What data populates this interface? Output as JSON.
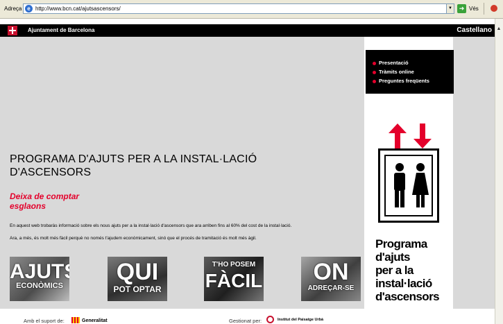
{
  "browser": {
    "address_label": "Adreça",
    "url": "http://www.bcn.cat/ajutsascensors/",
    "go_label": "Vés"
  },
  "site": {
    "name": "Ajuntament de Barcelona",
    "language_link": "Castellano"
  },
  "menu": {
    "items": [
      "Presentació",
      "Tràmits online",
      "Preguntes freqüents"
    ]
  },
  "content": {
    "title_line1": "PROGRAMA D'AJUTS PER A LA INSTAL·LACIÓ",
    "title_line2": "D'ASCENSORS",
    "slogan_line1": "Deixa de comptar",
    "slogan_line2": "esglaons",
    "paragraph1": "En aquest web trobaràs informació sobre els nous ajuts per a la instal·lació d'ascensors que ara arriben fins al 60% del cost de la instal·lació.",
    "paragraph2": "Ara, a més, és molt més fàcil perquè no només t'ajudem econòmicament, sinó que el procés de tramitació és molt més àgil."
  },
  "tiles": [
    {
      "big": "AJUTS",
      "small": "ECONÒMICS"
    },
    {
      "big": "QUI",
      "small": "POT OPTAR"
    },
    {
      "big": "FÀCIL",
      "small": "T'HO POSEM"
    },
    {
      "big": "ON",
      "small": "ADREÇAR-SE"
    }
  ],
  "promo": {
    "line1": "Programa",
    "line2": "d'ajuts",
    "line3": "per a la",
    "line4": "instal·lació",
    "line5": "d'ascensors"
  },
  "footer": {
    "support_label": "Amb el suport de:",
    "support_org": "Generalitat",
    "managed_label": "Gestionat per:",
    "managed_org": "Institut del Paisatge Urbà"
  },
  "colors": {
    "accent_red": "#e4002b",
    "header_black": "#000000",
    "main_gray": "#d9d9d9"
  }
}
